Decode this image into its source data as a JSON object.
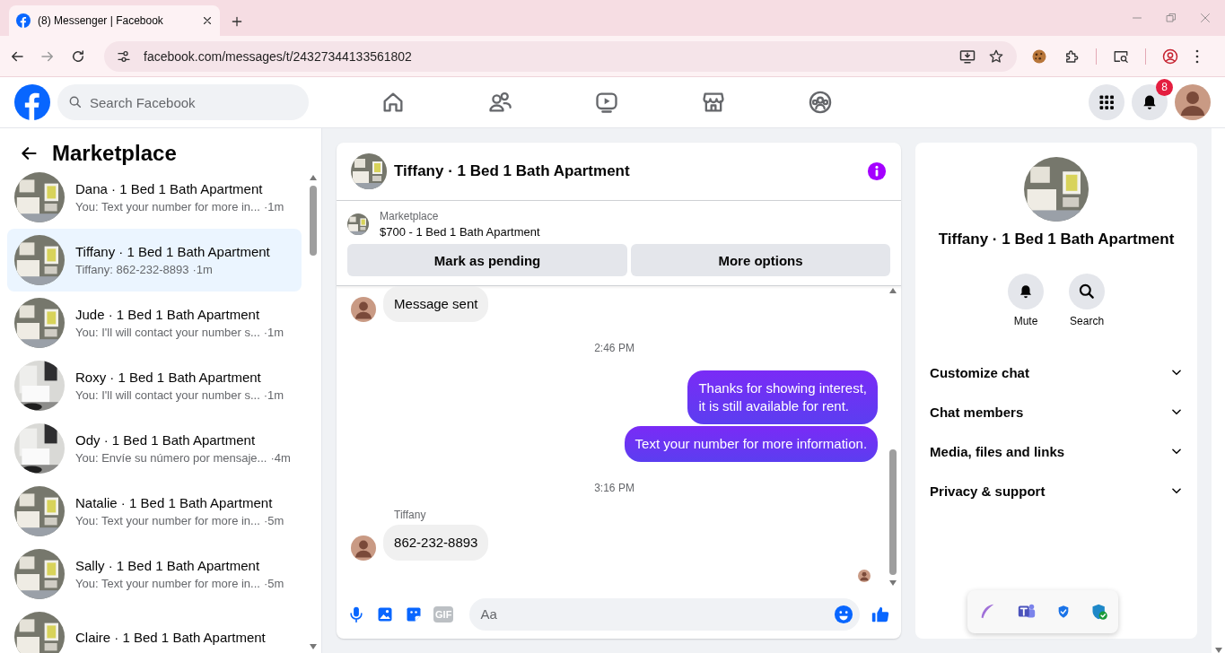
{
  "browser": {
    "tab_title": "(8) Messenger | Facebook",
    "url": "facebook.com/messages/t/24327344133561802"
  },
  "header": {
    "search": {
      "placeholder": "Search Facebook"
    },
    "notification_badge": "8"
  },
  "sidebar": {
    "title": "Marketplace",
    "conversations": [
      {
        "name": "Dana · 1 Bed 1 Bath Apartment",
        "preview": "You: Text your number for more in...",
        "time": "·1m",
        "selected": false
      },
      {
        "name": "Tiffany · 1 Bed 1 Bath Apartment",
        "preview": "Tiffany: 862-232-8893",
        "time": "·1m",
        "selected": true
      },
      {
        "name": "Jude · 1 Bed 1 Bath Apartment",
        "preview": "You: I'll will contact your number s...",
        "time": "·1m",
        "selected": false
      },
      {
        "name": "Roxy · 1 Bed 1 Bath Apartment",
        "preview": "You: I'll will contact your number s...",
        "time": "·1m",
        "selected": false
      },
      {
        "name": "Ody · 1 Bed 1 Bath Apartment",
        "preview": "You: Envíe su número por mensaje...",
        "time": "·4m",
        "selected": false
      },
      {
        "name": "Natalie · 1 Bed 1 Bath Apartment",
        "preview": "You: Text your number for more in...",
        "time": "·5m",
        "selected": false
      },
      {
        "name": "Sally · 1 Bed 1 Bath Apartment",
        "preview": "You: Text your number for more in...",
        "time": "·5m",
        "selected": false
      },
      {
        "name": "Claire · 1 Bed 1 Bath Apartment",
        "selected": false
      }
    ]
  },
  "chat": {
    "title": "Tiffany · 1 Bed 1 Bath Apartment",
    "listing": {
      "source": "Marketplace",
      "title": "$700 - 1 Bed 1 Bath Apartment"
    },
    "buttons": [
      "Mark as pending",
      "More options"
    ],
    "messages": [
      {
        "kind": "incoming",
        "text": "Message sent"
      },
      {
        "kind": "time",
        "text": "2:46 PM"
      },
      {
        "kind": "outgoing",
        "text": "Thanks for showing interest,\nit is still available for rent."
      },
      {
        "kind": "outgoing",
        "text": "Text your number for more information."
      },
      {
        "kind": "time",
        "text": "3:16 PM"
      },
      {
        "kind": "incoming",
        "sender": "Tiffany",
        "text": "862-232-8893"
      }
    ],
    "composer": {
      "gif": "GIF",
      "placeholder": "Aa"
    }
  },
  "details": {
    "name": "Tiffany · 1 Bed 1 Bath Apartment",
    "actions": [
      {
        "kind": "mute",
        "label": "Mute"
      },
      {
        "kind": "search",
        "label": "Search"
      }
    ],
    "sections": [
      {
        "label": "Customize chat",
        "expanded": false
      },
      {
        "label": "Chat members",
        "expanded": false
      },
      {
        "label": "Media, files and links",
        "expanded": false
      },
      {
        "label": "Privacy & support",
        "expanded": false
      }
    ]
  }
}
